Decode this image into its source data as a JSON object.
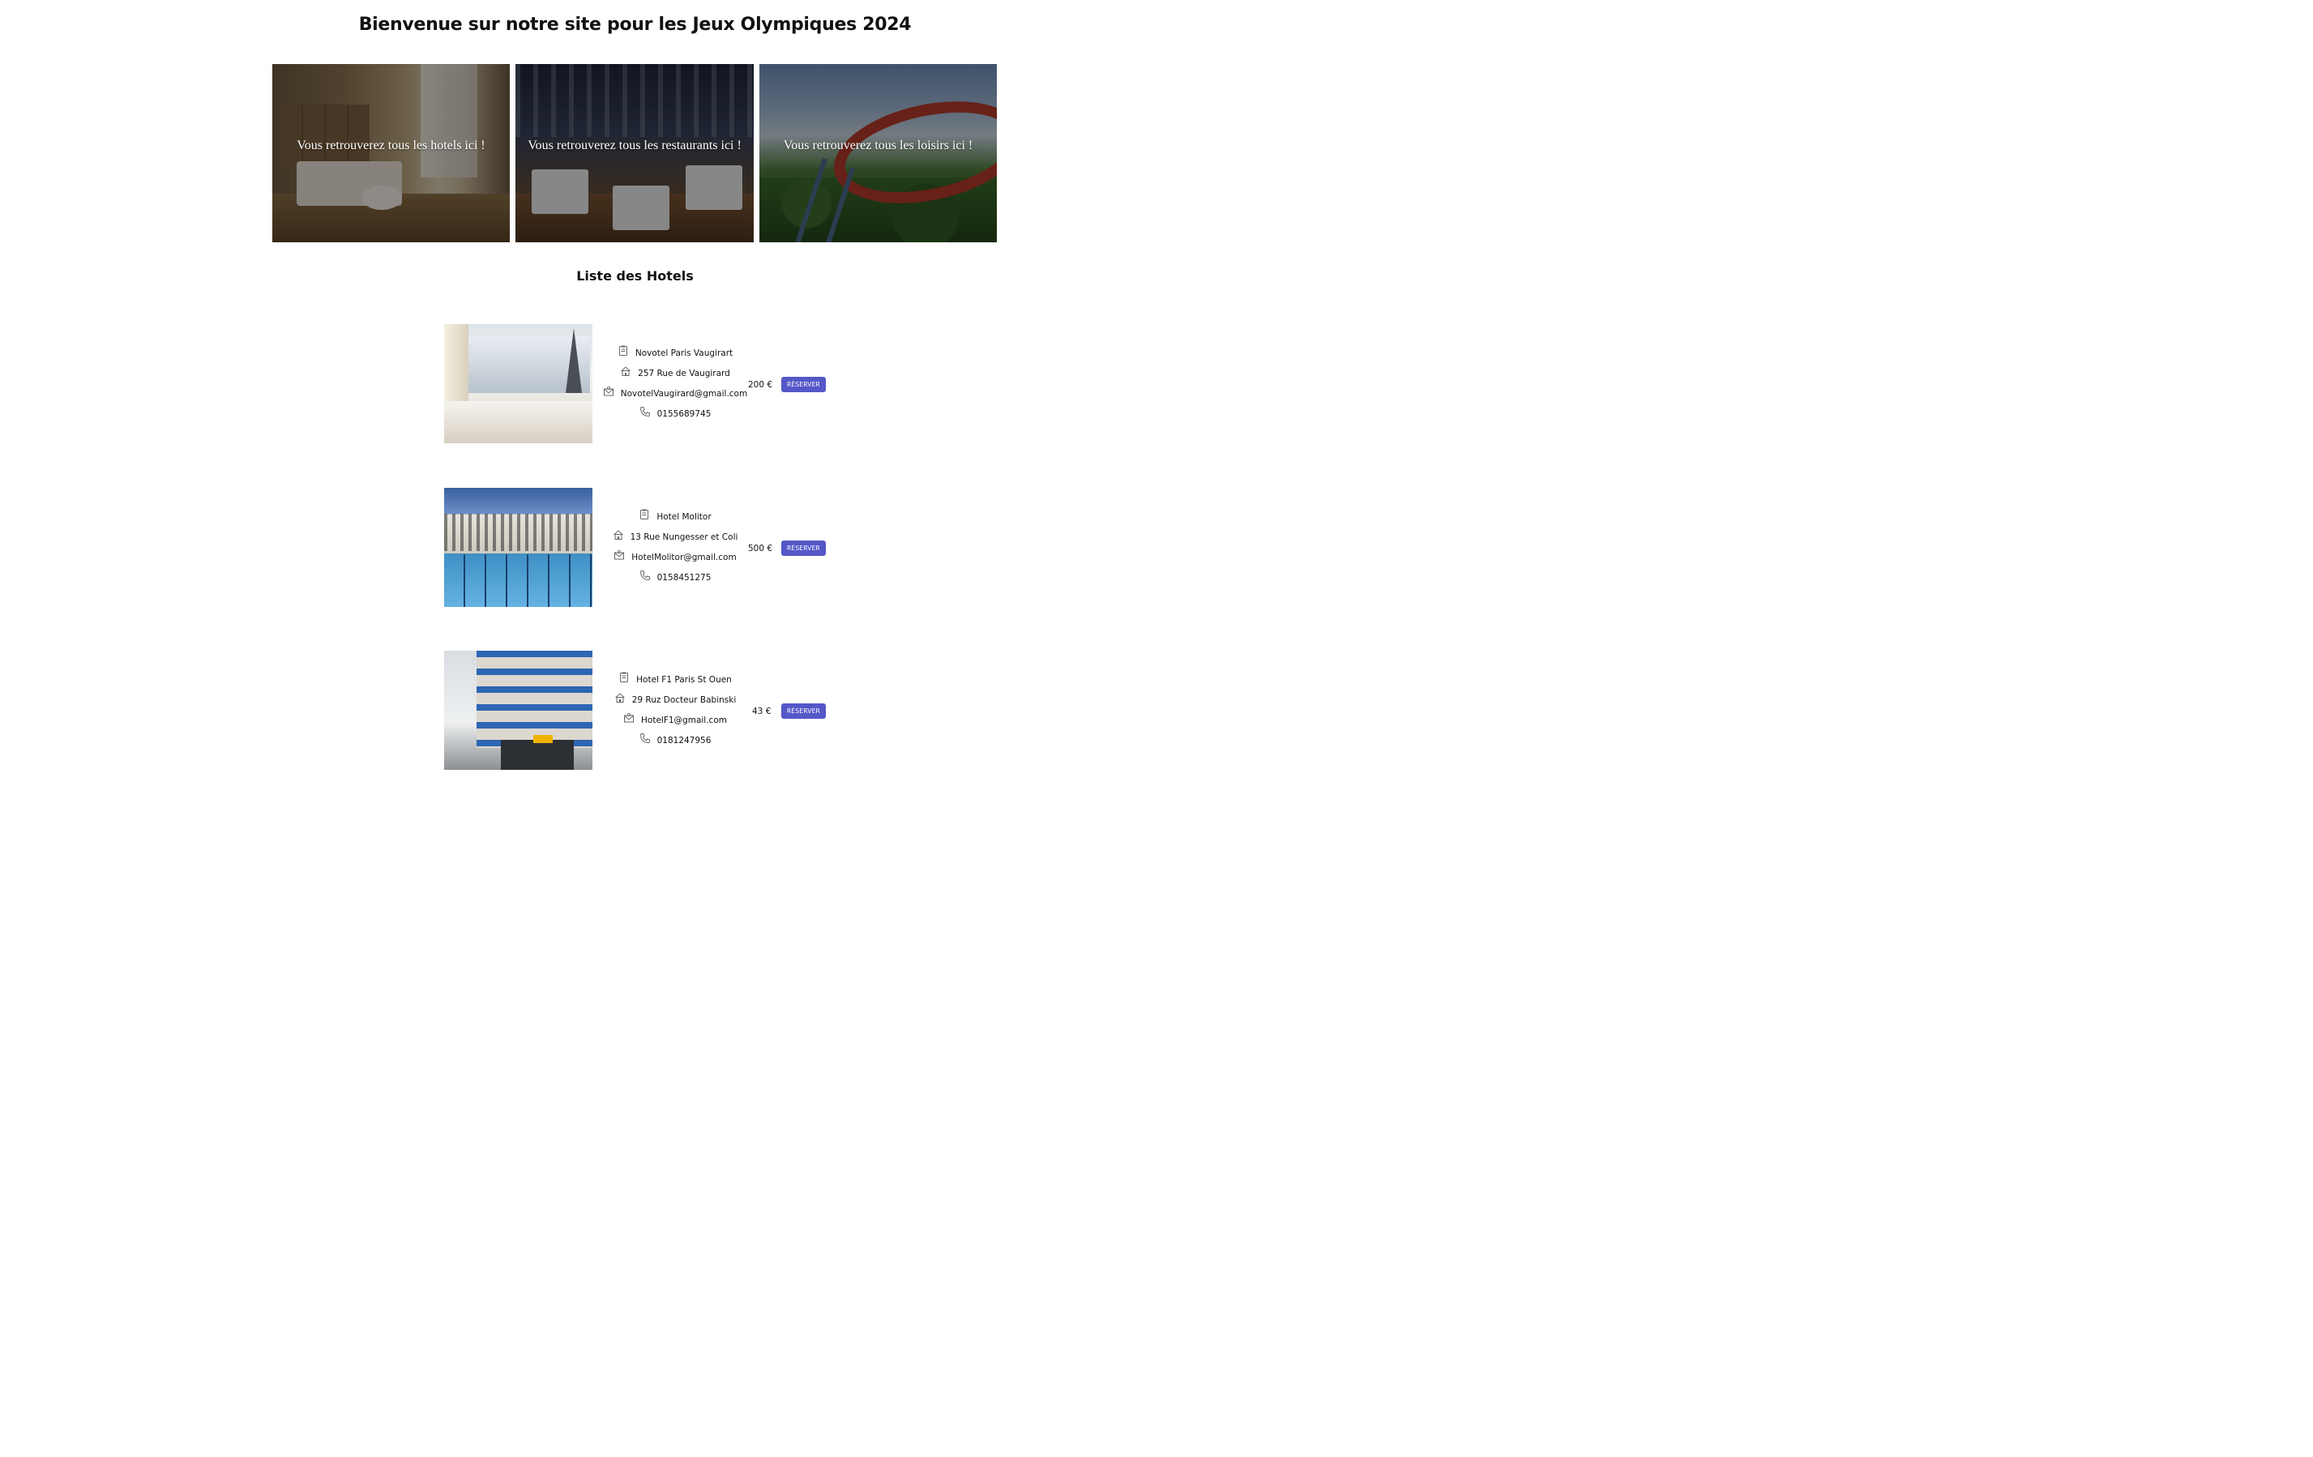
{
  "header": {
    "title": "Bienvenue sur notre site pour les Jeux Olympiques 2024"
  },
  "categories": [
    {
      "label": "Vous retrouverez tous les hotels ici !"
    },
    {
      "label": "Vous retrouverez tous les restaurants ici !"
    },
    {
      "label": "Vous retrouverez tous les loisirs ici !"
    }
  ],
  "hotels_section": {
    "title": "Liste des Hotels",
    "reserve_label": "RÉSERVER",
    "items": [
      {
        "name": "Novotel Paris Vaugirart",
        "address": "257 Rue de Vaugirard",
        "email": "NovotelVaugirard@gmail.com",
        "phone": "0155689745",
        "price": "200 €"
      },
      {
        "name": "Hotel Molitor",
        "address": "13 Rue Nungesser et Coli",
        "email": "HotelMolitor@gmail.com",
        "phone": "0158451275",
        "price": "500 €"
      },
      {
        "name": "Hotel F1 Paris St Ouen",
        "address": "29 Ruz Docteur Babinski",
        "email": "HotelF1@gmail.com",
        "phone": "0181247956",
        "price": "43 €"
      }
    ]
  },
  "icons": {
    "name": "document-icon",
    "address": "house-icon",
    "email": "mail-icon",
    "phone": "phone-icon"
  },
  "colors": {
    "reserve_button": "#5557c8",
    "text": "#111111"
  }
}
